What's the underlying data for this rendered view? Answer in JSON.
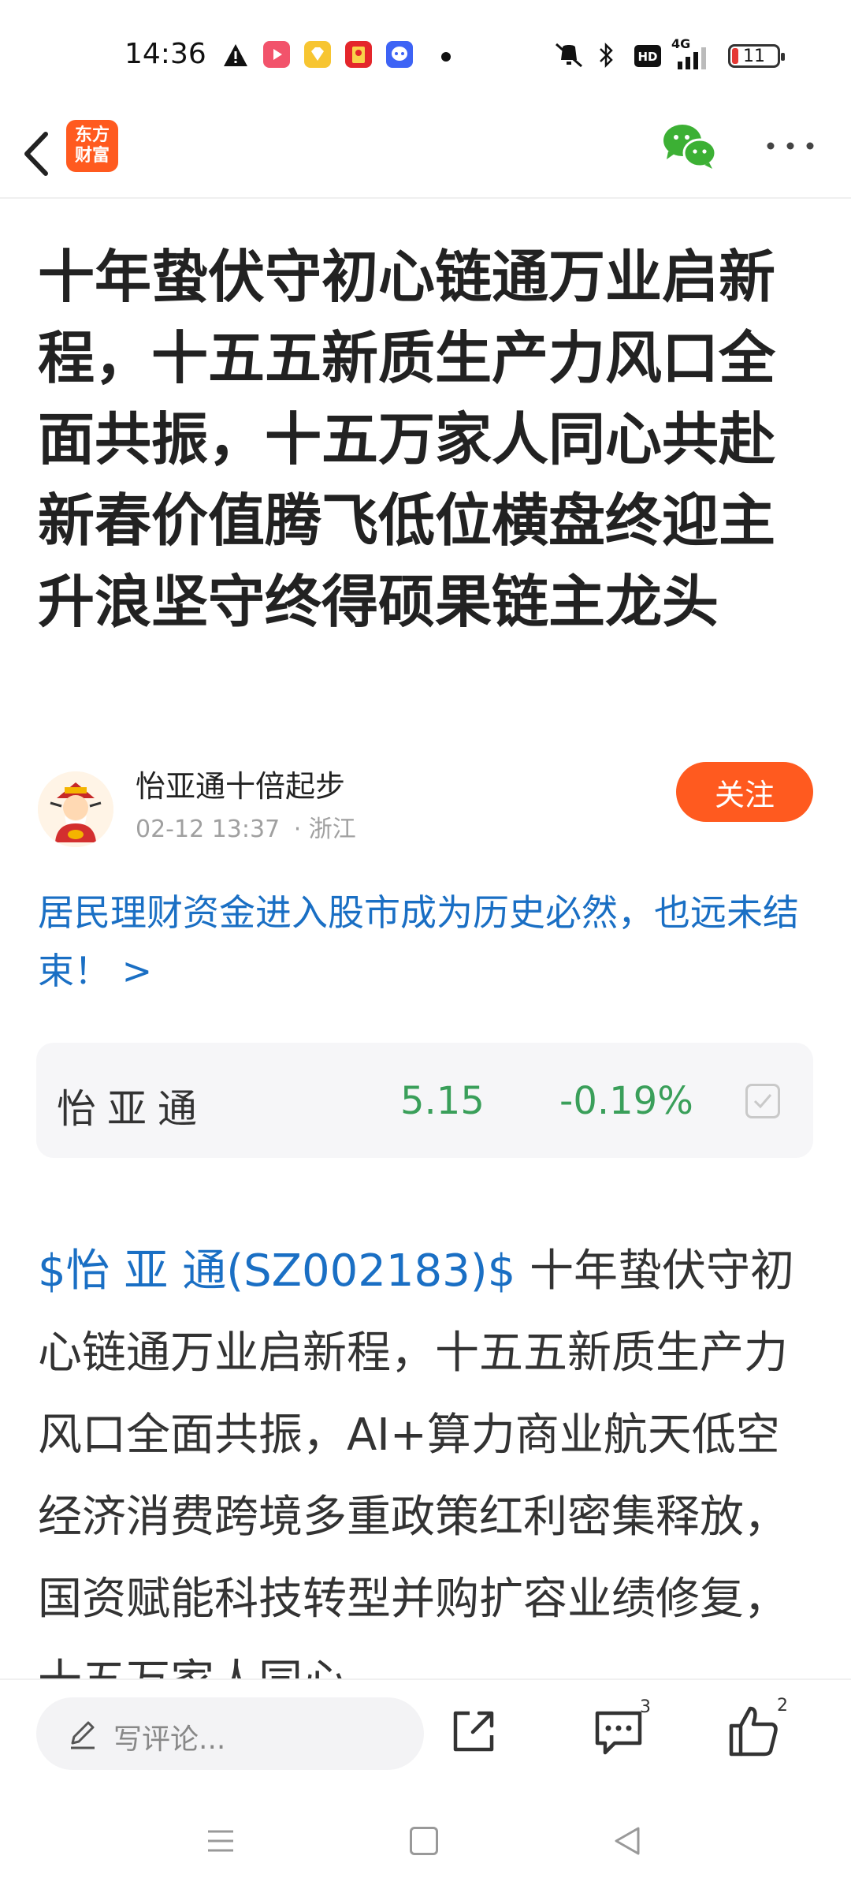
{
  "status_bar": {
    "time": "14:36",
    "network": "4G",
    "battery": "11",
    "icons": [
      "warning-icon",
      "video-app-icon",
      "diamond-app-icon",
      "red-envelope-app-icon",
      "chat-app-icon",
      "mute-icon",
      "bluetooth-icon",
      "hd-icon",
      "signal-icon",
      "battery-icon"
    ]
  },
  "header": {
    "logo_line1": "东方",
    "logo_line2": "财富",
    "icons": [
      "back-icon",
      "wechat-icon",
      "more-icon"
    ]
  },
  "article": {
    "title": "十年蛰伏守初心链通万业启新程，十五五新质生产力风口全面共振，十五万家人同心共赴新春价值腾飞低位横盘终迎主升浪坚守终得硕果链主龙头",
    "author": {
      "name": "怡亚通十倍起步",
      "time": "02-12 13:37",
      "location": "· 浙江",
      "follow_label": "关注"
    },
    "promo_link": "居民理财资金进入股市成为历史必然，也远未结束！ >",
    "stock": {
      "name": "怡亚通",
      "price": "5.15",
      "change": "-0.19%"
    },
    "body_tag": "$怡 亚 通(SZ002183)$",
    "body_text": " 十年蛰伏守初心链通万业启新程，十五五新质生产力风口全面共振，AI+算力商业航天低空经济消费跨境多重政策红利密集释放，国资赋能科技转型并购扩容业绩修复，十五万家人同心"
  },
  "bottom_bar": {
    "comment_placeholder": "写评论...",
    "comment_count": "3",
    "like_count": "2"
  },
  "colors": {
    "brand": "#ff5a1f",
    "link": "#1a6fc4",
    "stock_down": "#3a9f5a"
  }
}
